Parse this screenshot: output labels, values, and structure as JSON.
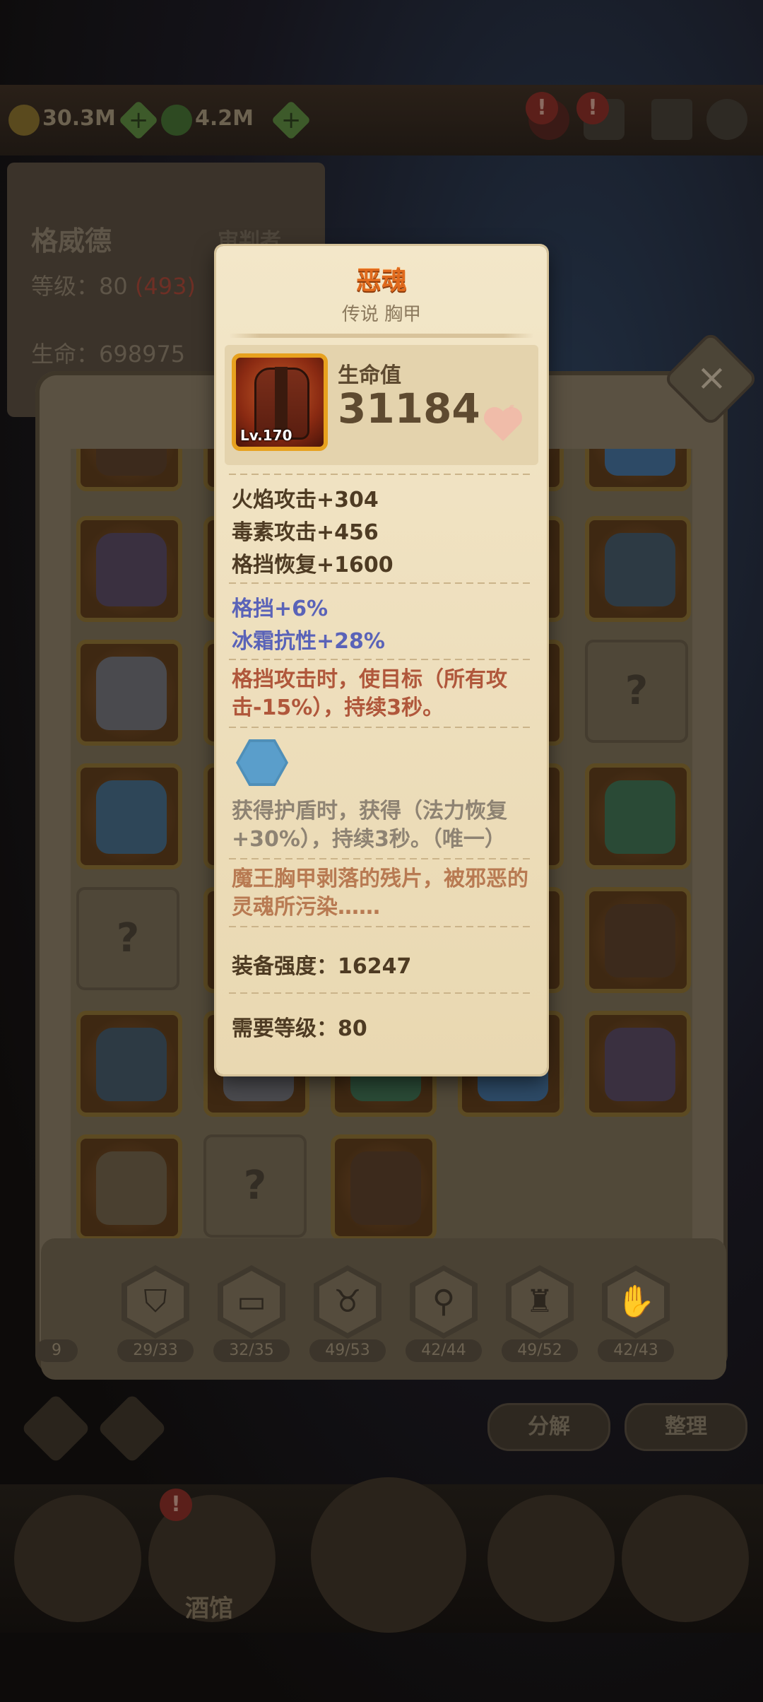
{
  "top_bar": {
    "gold": "30.3M",
    "gems": "4.2M"
  },
  "hero": {
    "name": "格威德",
    "role": "审判者",
    "level_label": "等级：80",
    "level_bonus": "(493)",
    "hp_label": "生命：698975"
  },
  "inventory_slots": [
    {
      "state": "filled"
    },
    {
      "state": "filled"
    },
    {
      "state": "filled"
    },
    {
      "state": "filled"
    },
    {
      "state": "filled"
    },
    {
      "state": "filled"
    },
    {
      "state": "filled"
    },
    {
      "state": "filled"
    },
    {
      "state": "filled"
    },
    {
      "state": "filled"
    },
    {
      "state": "filled"
    },
    {
      "state": "filled"
    },
    {
      "state": "filled"
    },
    {
      "state": "filled"
    },
    {
      "state": "empty",
      "label": "?"
    },
    {
      "state": "filled"
    },
    {
      "state": "filled"
    },
    {
      "state": "filled"
    },
    {
      "state": "filled"
    },
    {
      "state": "filled"
    },
    {
      "state": "empty",
      "label": "?"
    },
    {
      "state": "filled"
    },
    {
      "state": "filled"
    },
    {
      "state": "filled"
    },
    {
      "state": "filled"
    },
    {
      "state": "filled"
    },
    {
      "state": "filled"
    },
    {
      "state": "filled"
    },
    {
      "state": "filled"
    },
    {
      "state": "filled"
    },
    {
      "state": "filled"
    },
    {
      "state": "empty",
      "label": "?"
    },
    {
      "state": "filled"
    }
  ],
  "empty_label": "?",
  "categories": [
    {
      "icon": "shield-icon",
      "count": "29/33"
    },
    {
      "icon": "book-icon",
      "count": "32/35"
    },
    {
      "icon": "amulet-icon",
      "count": "49/53"
    },
    {
      "icon": "ring-icon",
      "count": "42/44"
    },
    {
      "icon": "armor-icon",
      "count": "49/52"
    },
    {
      "icon": "glove-icon",
      "count": "42/43"
    }
  ],
  "partial_category_count": "9",
  "buttons": {
    "disassemble": "分解",
    "sort": "整理"
  },
  "nav": {
    "tavern": "酒馆"
  },
  "tooltip": {
    "name": "恶魂",
    "subtitle": "传说 胸甲",
    "item_level": "Lv.170",
    "hp_label": "生命值",
    "hp_value": "31184",
    "base_stats": [
      "火焰攻击+304",
      "毒素攻击+456",
      "格挡恢复+1600"
    ],
    "bonus_stats": [
      "格挡+6%",
      "冰霜抗性+28%"
    ],
    "effect": "格挡攻击时，使目标（所有攻击-15%），持续3秒。",
    "socket_effect": "获得护盾时，获得（法力恢复+30%），持续3秒。（唯一）",
    "lore": "魔王胸甲剥落的残片，被邪恶的灵魂所污染……",
    "power_label": "装备强度：16247",
    "required_level_label": "需要等级：80"
  },
  "colors": {
    "title_orange": "#e06a1d",
    "bonus_blue": "#5a63b8",
    "effect_red": "#b0573b",
    "socket_blue": "#5a9ecb",
    "rarity_gold": "#e7a11f"
  }
}
